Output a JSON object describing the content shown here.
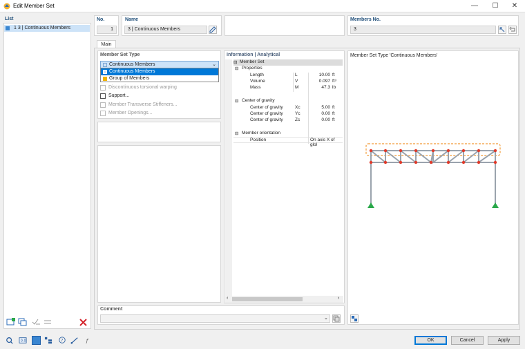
{
  "window": {
    "title": "Edit Member Set",
    "minimize_glyph": "—",
    "maximize_glyph": "☐",
    "close_glyph": "✕"
  },
  "list": {
    "header": "List",
    "items": [
      {
        "label": "1  3 | Continuous Members",
        "color": "#3a86d1"
      }
    ]
  },
  "header_fields": {
    "no_label": "No.",
    "no_value": "1",
    "name_label": "Name",
    "name_value": "3 | Continuous Members",
    "members_label": "Members No.",
    "members_value": "3"
  },
  "tabs": [
    {
      "label": "Main"
    }
  ],
  "member_set_type": {
    "label": "Member Set Type",
    "selected": "Continuous Members",
    "options": [
      {
        "label": "Continuous Members",
        "color": "#d3e4f5"
      },
      {
        "label": "Group of Members",
        "color": "#f0b400"
      }
    ]
  },
  "checkboxes": [
    {
      "label": "Discontinuous torsional warping",
      "enabled": false
    },
    {
      "label": "Support...",
      "enabled": true
    },
    {
      "label": "Member Transverse Stiffeners...",
      "enabled": false
    },
    {
      "label": "Member Openings...",
      "enabled": false
    }
  ],
  "info": {
    "header": "Information | Analytical",
    "groups": {
      "member_set": "Member Set",
      "properties": "Properties",
      "center_of_gravity": "Center of gravity",
      "member_orientation": "Member orientation"
    },
    "toggle_glyph": "⊟",
    "properties": [
      {
        "name": "Length",
        "symbol": "L",
        "value": "10.00",
        "unit": "ft"
      },
      {
        "name": "Volume",
        "symbol": "V",
        "value": "0.097",
        "unit": "ft³"
      },
      {
        "name": "Mass",
        "symbol": "M",
        "value": "47.3",
        "unit": "lb"
      }
    ],
    "cog": [
      {
        "name": "Center of gravity",
        "symbol": "Xc",
        "value": "5.00",
        "unit": "ft"
      },
      {
        "name": "Center of gravity",
        "symbol": "Yc",
        "value": "0.00",
        "unit": "ft"
      },
      {
        "name": "Center of gravity",
        "symbol": "Zc",
        "value": "0.00",
        "unit": "ft"
      }
    ],
    "orientation": {
      "name": "Position",
      "value": "On axis X of glol"
    }
  },
  "preview": {
    "caption": "Member Set Type 'Continuous Members'"
  },
  "comment": {
    "label": "Comment",
    "value": ""
  },
  "footer": {
    "ok": "OK",
    "cancel": "Cancel",
    "apply": "Apply"
  },
  "colors": {
    "accent": "#0078d7",
    "node": "#e03a2a",
    "support": "#2aa84a",
    "frame": "#9aa3ad",
    "highlight": "#f29b38"
  }
}
